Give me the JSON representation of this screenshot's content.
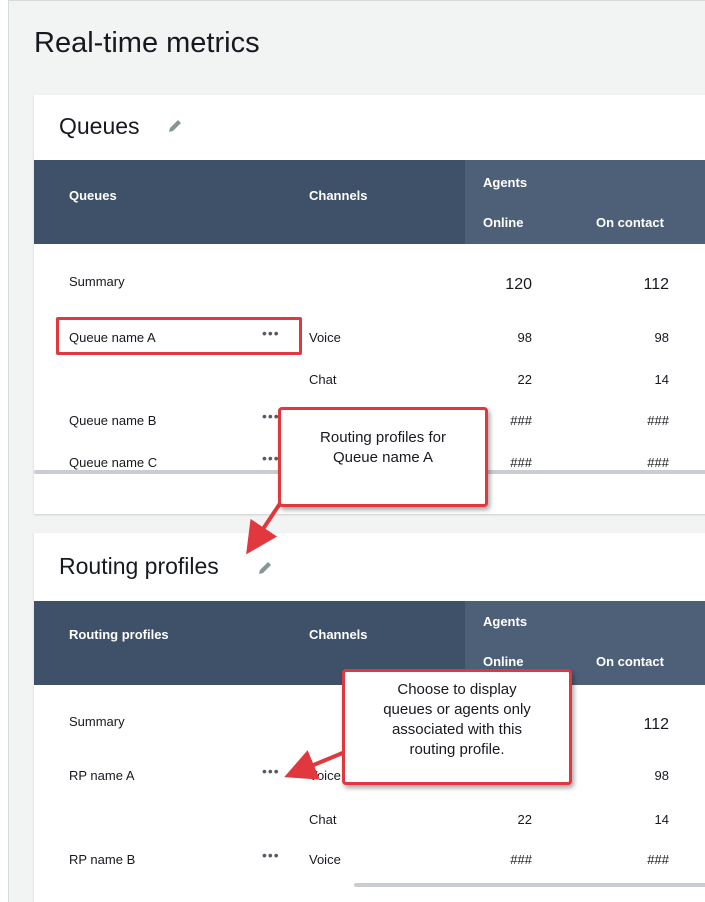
{
  "page": {
    "title": "Real-time metrics"
  },
  "queues_panel": {
    "title": "Queues",
    "headers": {
      "name": "Queues",
      "channels": "Channels",
      "agents_group": "Agents",
      "online": "Online",
      "on_contact": "On contact"
    },
    "summary": {
      "label": "Summary",
      "online": "120",
      "on_contact": "112"
    },
    "rows": [
      {
        "name": "Queue name A",
        "channel": "Voice",
        "online": "98",
        "on_contact": "98"
      },
      {
        "name": "",
        "channel": "Chat",
        "online": "22",
        "on_contact": "14"
      },
      {
        "name": "Queue name B",
        "channel": "",
        "online": "###",
        "on_contact": "###"
      },
      {
        "name": "Queue name C",
        "channel": "",
        "online": "###",
        "on_contact": "###"
      }
    ]
  },
  "routing_panel": {
    "title": "Routing profiles",
    "headers": {
      "name": "Routing profiles",
      "channels": "Channels",
      "agents_group": "Agents",
      "online": "Online",
      "on_contact": "On contact"
    },
    "summary": {
      "label": "Summary",
      "on_contact": "112"
    },
    "rows": [
      {
        "name": "RP name A",
        "channel": "Voice",
        "online": "",
        "on_contact": "98"
      },
      {
        "name": "",
        "channel": "Chat",
        "online": "22",
        "on_contact": "14"
      },
      {
        "name": "RP name B",
        "channel": "Voice",
        "online": "###",
        "on_contact": "###"
      }
    ]
  },
  "annotations": {
    "callout_queue": "Routing profiles for\nQueue name A",
    "callout_rp": "Choose to display\nqueues or agents only\nassociated with this\nrouting profile."
  },
  "icons": {
    "edit": "pencil-icon",
    "more": "ellipsis-icon"
  },
  "colors": {
    "header": "#3e5169",
    "annotation": "#e0383e"
  }
}
